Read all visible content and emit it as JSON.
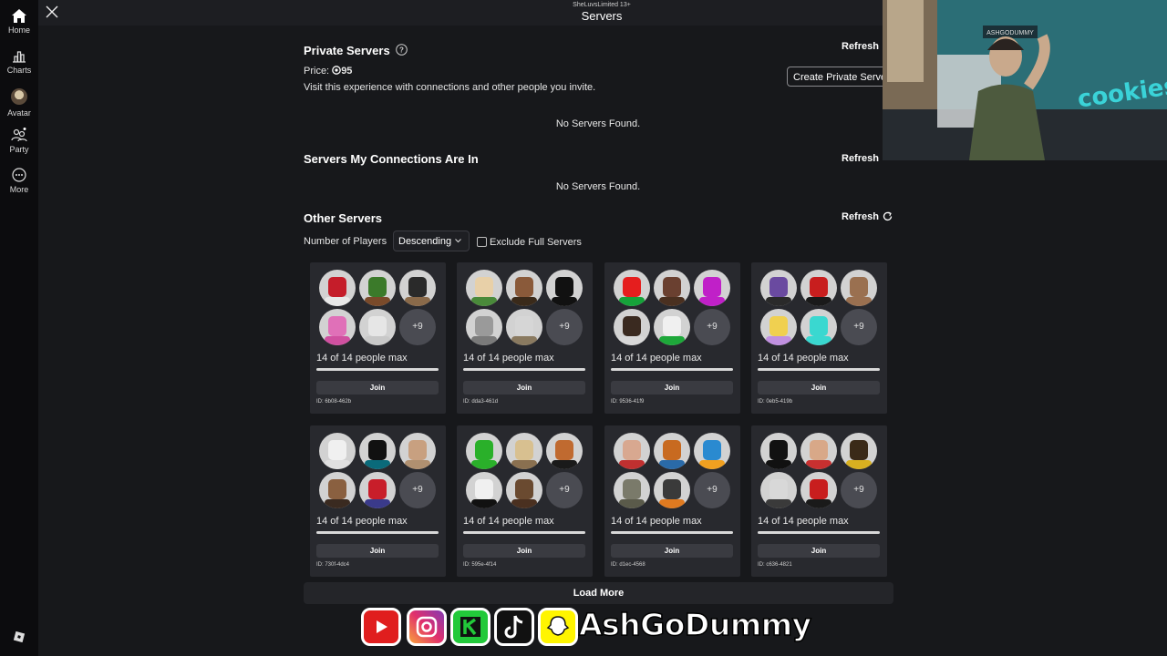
{
  "nav": [
    {
      "label": "Home",
      "icon": "home-icon"
    },
    {
      "label": "Charts",
      "icon": "charts-icon"
    },
    {
      "label": "Avatar",
      "icon": "avatar-icon"
    },
    {
      "label": "Party",
      "icon": "party-icon"
    },
    {
      "label": "More",
      "icon": "more-icon"
    }
  ],
  "header": {
    "subtitle": "SheLuvsLimited 13+",
    "title": "Servers"
  },
  "private": {
    "title": "Private Servers",
    "refresh": "Refresh",
    "price_label": "Price:",
    "price_value": "95",
    "description": "Visit this experience with connections and other people you invite.",
    "create_button": "Create Private Serve",
    "empty": "No Servers Found."
  },
  "connections": {
    "title": "Servers My Connections Are In",
    "refresh": "Refresh",
    "empty": "No Servers Found."
  },
  "other": {
    "title": "Other Servers",
    "refresh": "Refresh",
    "sort_label": "Number of Players",
    "sort_value": "Descending",
    "exclude_label": "Exclude Full Servers"
  },
  "servers": [
    {
      "count": "14 of 14 people max",
      "join": "Join",
      "id": "ID: 6b08-462b",
      "more": "+9",
      "fill": 1.0
    },
    {
      "count": "14 of 14 people max",
      "join": "Join",
      "id": "ID: dda3-461d",
      "more": "+9",
      "fill": 1.0
    },
    {
      "count": "14 of 14 people max",
      "join": "Join",
      "id": "ID: 9536-41f9",
      "more": "+9",
      "fill": 1.0
    },
    {
      "count": "14 of 14 people max",
      "join": "Join",
      "id": "ID: 0eb5-419b",
      "more": "+9",
      "fill": 1.0
    },
    {
      "count": "14 of 14 people max",
      "join": "Join",
      "id": "ID: 730f-4dc4",
      "more": "+9",
      "fill": 1.0
    },
    {
      "count": "14 of 14 people max",
      "join": "Join",
      "id": "ID: 595e-4f14",
      "more": "+9",
      "fill": 1.0
    },
    {
      "count": "14 of 14 people max",
      "join": "Join",
      "id": "ID: d1ec-4568",
      "more": "+9",
      "fill": 1.0
    },
    {
      "count": "14 of 14 people max",
      "join": "Join",
      "id": "ID: c636-4821",
      "more": "+9",
      "fill": 1.0
    }
  ],
  "load_more": "Load More",
  "overlay": {
    "brand": "AshGoDummy",
    "banner_text": "ASHGODUMMY",
    "wall_text": "cookies"
  },
  "colors": {
    "background": "#17181b",
    "card": "#28292e",
    "topbar": "#1d1e22"
  }
}
